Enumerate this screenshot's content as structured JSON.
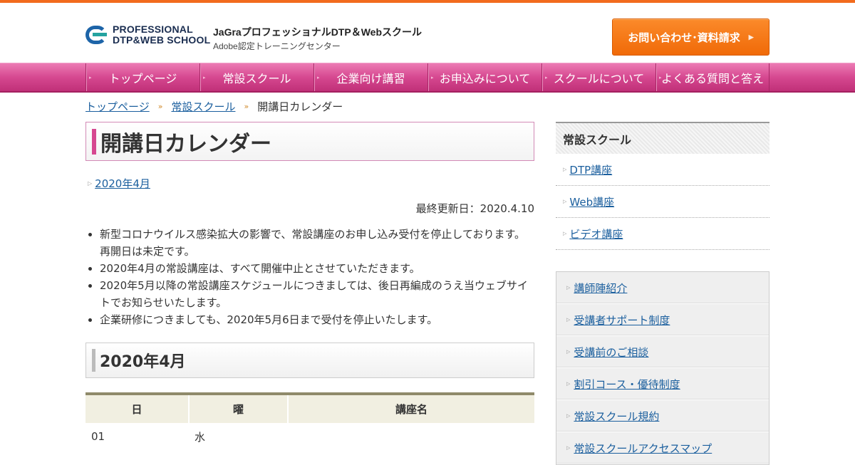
{
  "header": {
    "logo_line1": "PROFESSIONAL",
    "logo_line2": "DTP&WEB SCHOOL",
    "site_title": "JaGraプロフェッショナルDTP＆Webスクール",
    "site_subtitle": "Adobe認定トレーニングセンター",
    "contact_button": "お問い合わせ･資料請求",
    "accent_color": "#f26b1d"
  },
  "nav": {
    "items": [
      "トップページ",
      "常設スクール",
      "企業向け講習",
      "お申込みについて",
      "スクールについて",
      "よくある質問と答え"
    ],
    "color": "#d64890"
  },
  "breadcrumb": {
    "items": [
      "トップページ",
      "常設スクール"
    ],
    "current": "開講日カレンダー"
  },
  "main": {
    "title": "開講日カレンダー",
    "month_link": "2020年4月",
    "updated": "最終更新日：2020.4.10",
    "notes": [
      "新型コロナウイルス感染拡大の影響で、常設講座のお申し込み受付を停止しております。再開日は未定です。",
      "2020年4月の常設講座は、すべて開催中止とさせていただきます。",
      "2020年5月以降の常設講座スケジュールにつきましては、後日再編成のうえ当ウェブサイトでお知らせいたします。",
      "企業研修につきましても、2020年5月6日まで受付を停止いたします。"
    ],
    "section_title": "2020年4月",
    "table": {
      "headers": [
        "日",
        "曜",
        "講座名"
      ],
      "rows": [
        [
          "01",
          "水",
          ""
        ]
      ]
    }
  },
  "sidebar": {
    "title": "常設スクール",
    "courses": [
      "DTP講座",
      "Web講座",
      "ビデオ講座"
    ],
    "links": [
      "講師陣紹介",
      "受講者サポート制度",
      "受講前のご相談",
      "割引コース・優待制度",
      "常設スクール規約",
      "常設スクールアクセスマップ"
    ]
  }
}
